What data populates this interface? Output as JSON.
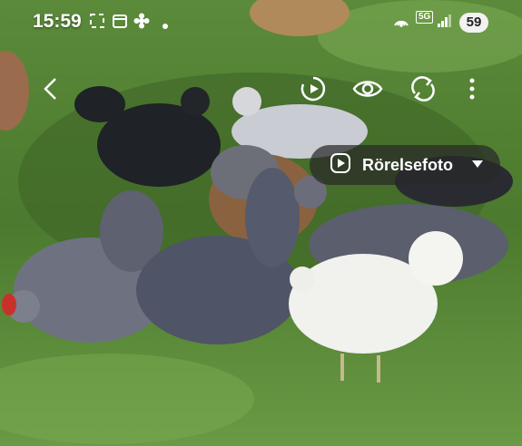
{
  "status_bar": {
    "time": "15:59",
    "network": "5G",
    "battery": "59"
  },
  "toolbar": {
    "back_icon": "chevron-left-icon",
    "motion_play_icon": "motion-play-icon",
    "view_icon": "eye-icon",
    "rotate_icon": "rotate-icon",
    "more_icon": "more-vertical-icon"
  },
  "motion_menu": {
    "label": "Rörelsefoto",
    "icon": "play-circle-icon",
    "caret_icon": "caret-down-icon"
  }
}
